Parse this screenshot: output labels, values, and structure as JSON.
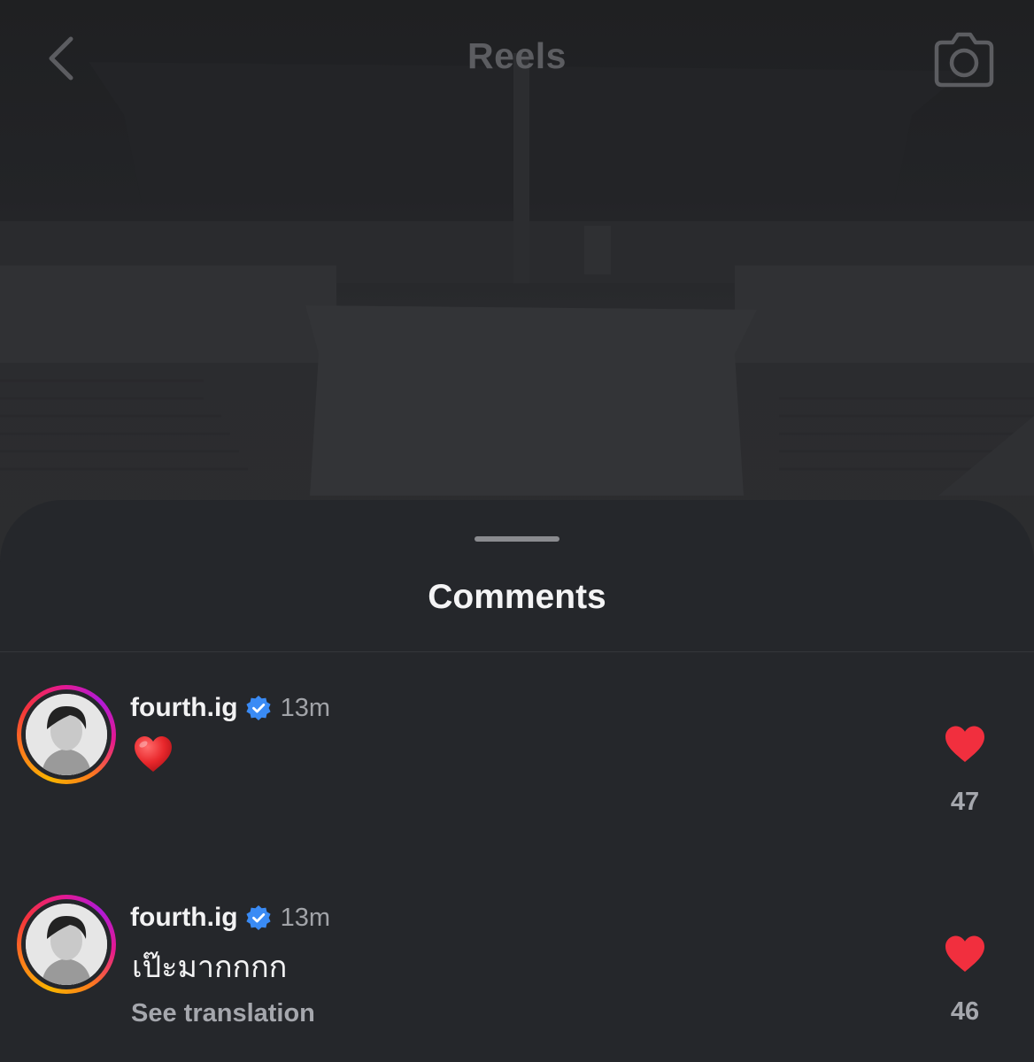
{
  "header": {
    "title": "Reels",
    "back_icon": "chevron-left-icon",
    "camera_icon": "camera-icon"
  },
  "sheet": {
    "title": "Comments"
  },
  "colors": {
    "sheet_background": "#25272b",
    "like_red": "#f12f3e",
    "verified_blue": "#3a8bf5",
    "secondary_text": "#a5a7ad"
  },
  "comments": [
    {
      "username": "fourth.ig",
      "verified": true,
      "time": "13m",
      "text": "❤️",
      "text_is_emoji": true,
      "liked": true,
      "likes": "47"
    },
    {
      "username": "fourth.ig",
      "verified": true,
      "time": "13m",
      "text": "เป๊ะมากกกก",
      "see_translation": "See translation",
      "liked": true,
      "likes": "46"
    }
  ]
}
